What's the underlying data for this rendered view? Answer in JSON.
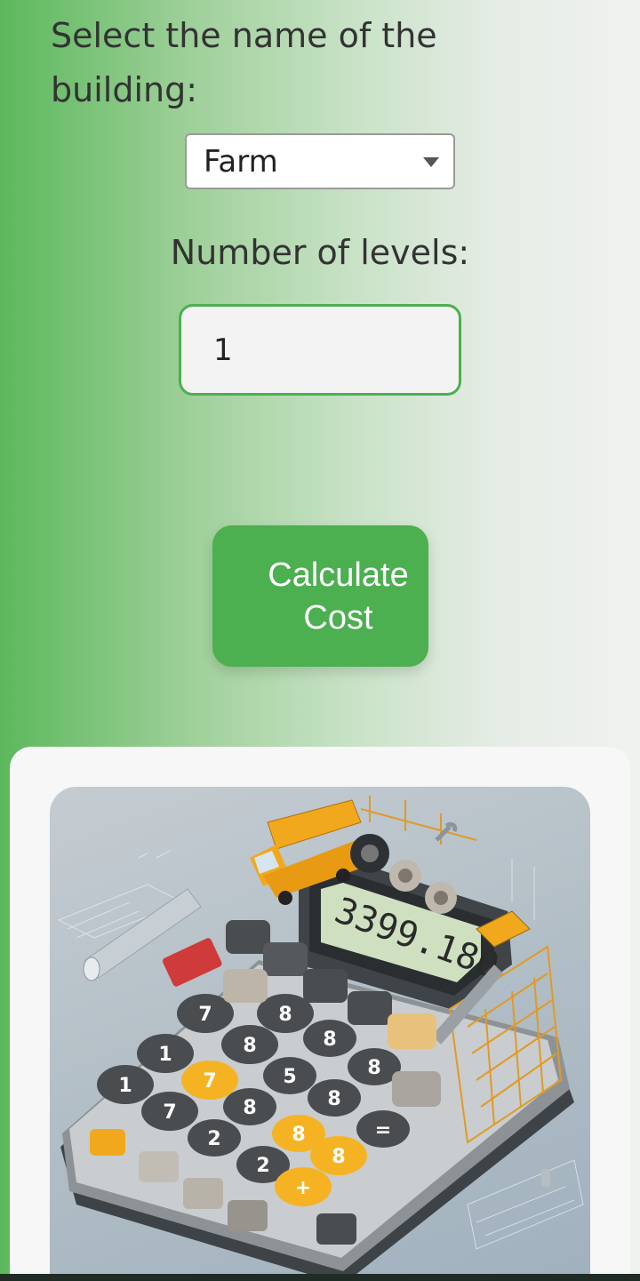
{
  "form": {
    "building_label": "Select the name of the building:",
    "building_selected": "Farm",
    "levels_label": "Number of levels:",
    "levels_value": "1",
    "calculate_label": "Calculate Cost"
  },
  "illustration": {
    "display_readout": "3399.180",
    "key_labels": [
      "7",
      "8",
      "8",
      "1",
      "8",
      "8",
      "1",
      "7",
      "5",
      "8",
      "7",
      "8",
      "8",
      "2",
      "8",
      "=",
      "2",
      "+"
    ]
  },
  "colors": {
    "accent": "#4caf50",
    "keys_dark": "#4a4d50",
    "keys_yellow": "#f5b324",
    "truck": "#f2a81d",
    "lcd": "#cfe0c0"
  }
}
